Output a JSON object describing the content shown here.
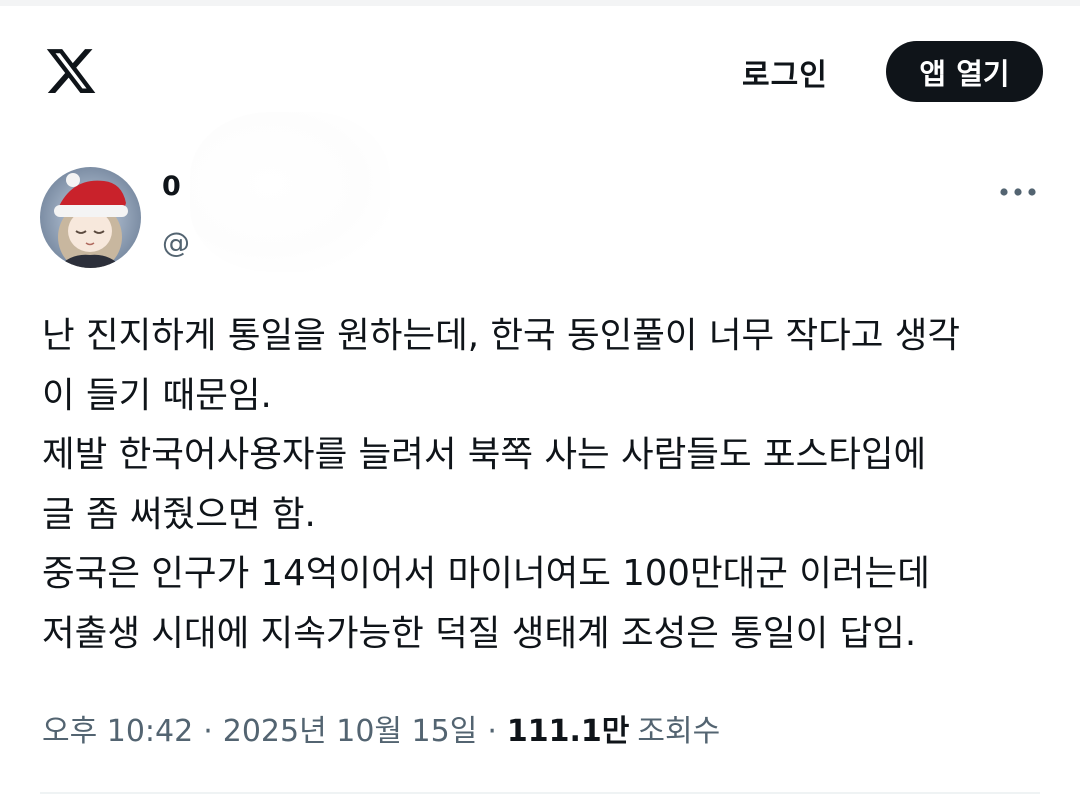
{
  "header": {
    "logo_icon": "x-logo-icon",
    "login_label": "로그인",
    "open_app_label": "앱 열기"
  },
  "tweet": {
    "author": {
      "display_name": "0",
      "handle": "@",
      "avatar_icon": "avatar-image"
    },
    "more_icon": "more-options-icon",
    "text_lines": [
      "난 진지하게 통일을 원하는데, 한국 동인풀이 너무 작다고 생각",
      "이 들기 때문임.",
      "제발 한국어사용자를 늘려서 북쪽 사는 사람들도 포스타입에",
      "글 좀 써줬으면 함.",
      "중국은 인구가 14억이어서 마이너여도 100만대군 이러는데",
      "저출생 시대에 지속가능한 덕질 생태계 조성은 통일이 답임."
    ],
    "meta": {
      "time": "오후 10:42",
      "separator": "·",
      "date": "2025년 10월 15일",
      "views_count": "111.1만",
      "views_label": "조회수"
    }
  },
  "colors": {
    "text_primary": "#0f1419",
    "text_secondary": "#536471",
    "button_bg": "#0f1419",
    "button_text": "#ffffff",
    "divider": "#eff3f4"
  }
}
